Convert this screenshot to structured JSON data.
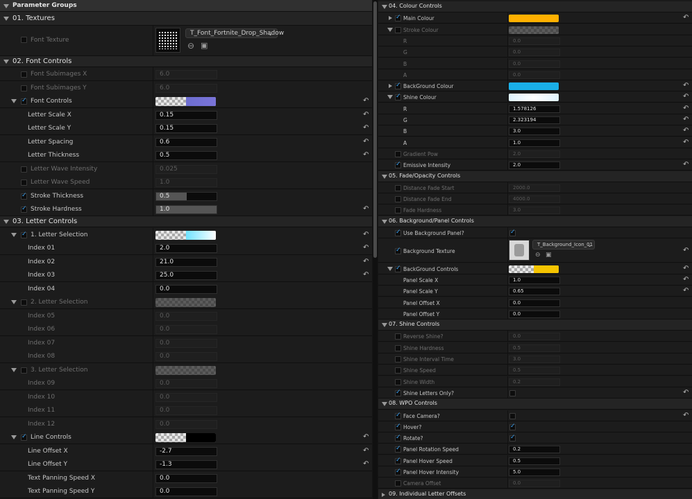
{
  "title": "Parameter Groups",
  "left": {
    "g01": {
      "label": "01. Textures",
      "font_texture": "Font Texture",
      "asset": "T_Font_Fortnite_Drop_Shadow"
    },
    "g02": {
      "label": "02. Font Controls",
      "sub_x": {
        "label": "Font Subimages X",
        "value": "6.0"
      },
      "sub_y": {
        "label": "Font Subimages Y",
        "value": "6.0"
      },
      "font_controls": "Font Controls",
      "scale_x": {
        "label": "Letter Scale X",
        "value": "0.15"
      },
      "scale_y": {
        "label": "Letter Scale Y",
        "value": "0.15"
      },
      "spacing": {
        "label": "Letter Spacing",
        "value": "0.6"
      },
      "thickness": {
        "label": "Letter Thickness",
        "value": "0.5"
      },
      "wave_int": {
        "label": "Letter Wave Intensity",
        "value": "0.025"
      },
      "wave_speed": {
        "label": "Letter Wave Speed",
        "value": "1.0"
      },
      "stroke_th": {
        "label": "Stroke Thickness",
        "value": "0.5"
      },
      "stroke_hd": {
        "label": "Stroke Hardness",
        "value": "1.0"
      }
    },
    "g03": {
      "label": "03. Letter Controls",
      "sel1": "1. Letter Selection",
      "i01": {
        "label": "Index 01",
        "value": "2.0"
      },
      "i02": {
        "label": "Index 02",
        "value": "21.0"
      },
      "i03": {
        "label": "Index 03",
        "value": "25.0"
      },
      "i04": {
        "label": "Index 04",
        "value": "0.0"
      },
      "sel2": "2. Letter Selection",
      "i05": {
        "label": "Index 05",
        "value": "0.0"
      },
      "i06": {
        "label": "Index 06",
        "value": "0.0"
      },
      "i07": {
        "label": "Index 07",
        "value": "0.0"
      },
      "i08": {
        "label": "Index 08",
        "value": "0.0"
      },
      "sel3": "3. Letter Selection",
      "i09": {
        "label": "Index 09",
        "value": "0.0"
      },
      "i10": {
        "label": "Index 10",
        "value": "0.0"
      },
      "i11": {
        "label": "Index 11",
        "value": "0.0"
      },
      "i12": {
        "label": "Index 12",
        "value": "0.0"
      },
      "line_controls": "Line Controls",
      "lox": {
        "label": "Line Offset X",
        "value": "-2.7"
      },
      "loy": {
        "label": "Line Offset Y",
        "value": "-1.3"
      },
      "tpx": {
        "label": "Text Panning Speed X",
        "value": "0.0"
      },
      "tpy": {
        "label": "Text Panning Speed Y",
        "value": "0.0"
      }
    }
  },
  "right": {
    "g04": {
      "label": "04. Colour Controls",
      "main": "Main Colour",
      "stroke": "Stroke Colour",
      "sr": {
        "label": "R",
        "value": "0.0"
      },
      "sg": {
        "label": "G",
        "value": "0.0"
      },
      "sb": {
        "label": "B",
        "value": "0.0"
      },
      "sa": {
        "label": "A",
        "value": "0.0"
      },
      "bg": "BackGround Colour",
      "shine": "Shine Colour",
      "hr": {
        "label": "R",
        "value": "1.578126"
      },
      "hg": {
        "label": "G",
        "value": "2.323194"
      },
      "hb": {
        "label": "B",
        "value": "3.0"
      },
      "ha": {
        "label": "A",
        "value": "1.0"
      },
      "gp": {
        "label": "Gradient Pow",
        "value": "2.0"
      },
      "ei": {
        "label": "Emissive Intensity",
        "value": "2.0"
      }
    },
    "g05": {
      "label": "05. Fade/Opacity Controls",
      "dfs": {
        "label": "Distance Fade Start",
        "value": "2000.0"
      },
      "dfe": {
        "label": "Distance Fade End",
        "value": "4000.0"
      },
      "fh": {
        "label": "Fade Hardness",
        "value": "3.0"
      }
    },
    "g06": {
      "label": "06. Background/Panel Controls",
      "ubp": "Use Background Panel?",
      "bt": "Background Texture",
      "asset": "T_Background_Icon_01",
      "bc": "BackGround Controls",
      "psx": {
        "label": "Panel Scale X",
        "value": "1.0"
      },
      "psy": {
        "label": "Panel Scale Y",
        "value": "0.65"
      },
      "pox": {
        "label": "Panel Offset X",
        "value": "0.0"
      },
      "poy": {
        "label": "Panel Offset Y",
        "value": "0.0"
      }
    },
    "g07": {
      "label": "07. Shine Controls",
      "rs": {
        "label": "Reverse Shine?",
        "value": "0.0"
      },
      "sh": {
        "label": "Shine Hardness",
        "value": "0.5"
      },
      "sit": {
        "label": "Shine Interval Time",
        "value": "3.0"
      },
      "ss": {
        "label": "Shine Speed",
        "value": "0.5"
      },
      "sw": {
        "label": "Shine Width",
        "value": "0.2"
      },
      "slo": "Shine Letters Only?"
    },
    "g08": {
      "label": "08. WPO Controls",
      "fc": "Face Camera?",
      "hv": "Hover?",
      "rt": "Rotate?",
      "prs": {
        "label": "Panel Rotation Speed",
        "value": "0.2"
      },
      "phs": {
        "label": "Panel Hover Speed",
        "value": "0.5"
      },
      "phi": {
        "label": "Panel Hover Intensity",
        "value": "5.0"
      },
      "co": {
        "label": "Camera Offset",
        "value": "0.0"
      }
    },
    "g09": {
      "label": "09. Individual Letter Offsets"
    }
  },
  "colors": {
    "main": "#ffb000",
    "background": "#1aafe8",
    "font_controls": "#6d6ed0",
    "bg_controls": "#f5c400"
  },
  "fills": {
    "stroke_thickness": 0.5,
    "stroke_hardness": 1.0
  },
  "icons": {
    "reset": "reset-arrow-icon",
    "browse": "browse-icon",
    "use": "use-selected-icon",
    "check": "checkmark-icon"
  }
}
